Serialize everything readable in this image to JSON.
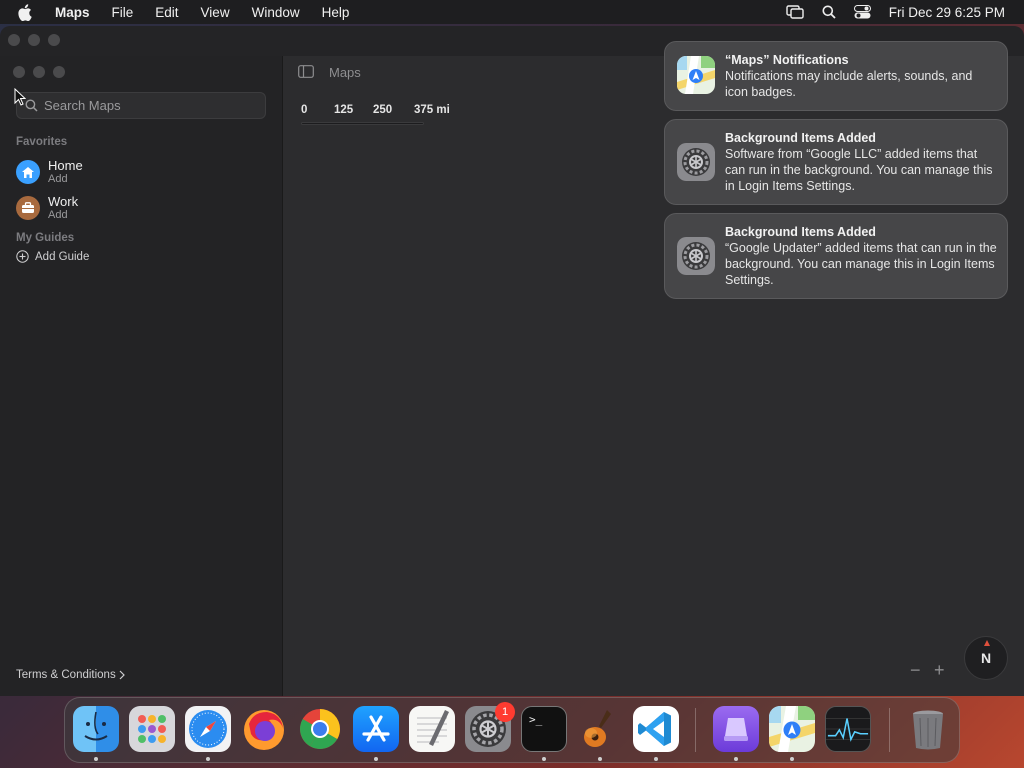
{
  "menubar": {
    "app": "Maps",
    "items": [
      "File",
      "Edit",
      "View",
      "Window",
      "Help"
    ],
    "clock": "Fri Dec 29  6:25 PM"
  },
  "window": {
    "title": "Maps"
  },
  "sidebar": {
    "search_placeholder": "Search Maps",
    "favorites_label": "Favorites",
    "favorites": [
      {
        "title": "Home",
        "subtitle": "Add",
        "icon": "home-icon",
        "color": "#3aa0ff"
      },
      {
        "title": "Work",
        "subtitle": "Add",
        "icon": "briefcase-icon",
        "color": "#a86a3e"
      }
    ],
    "guides_label": "My Guides",
    "add_guide": "Add Guide",
    "terms": "Terms & Conditions"
  },
  "map": {
    "scale": [
      "0",
      "125",
      "250",
      "375 mi"
    ],
    "zoom_out": "−",
    "zoom_in": "+",
    "compass": "N"
  },
  "notifications": [
    {
      "title": "“Maps” Notifications",
      "message": "Notifications may include alerts, sounds, and icon badges.",
      "icon": "maps-app-icon"
    },
    {
      "title": "Background Items Added",
      "message": "Software from “Google LLC” added items that can run in the background. You can manage this in Login Items Settings.",
      "icon": "system-settings-icon"
    },
    {
      "title": "Background Items Added",
      "message": "“Google Updater” added items that can run in the background. You can manage this in Login Items Settings.",
      "icon": "system-settings-icon"
    }
  ],
  "dock": {
    "apps": [
      "finder-icon",
      "launchpad-icon",
      "safari-icon",
      "firefox-icon",
      "chrome-icon",
      "app-store-icon",
      "textedit-icon",
      "system-settings-icon",
      "terminal-icon",
      "garageband-icon",
      "vscode-icon",
      "podcasts-storage-icon",
      "maps-app-icon",
      "activity-monitor-icon",
      "trash-icon"
    ],
    "settings_badge": "1",
    "terminal_prompt": ">_"
  }
}
